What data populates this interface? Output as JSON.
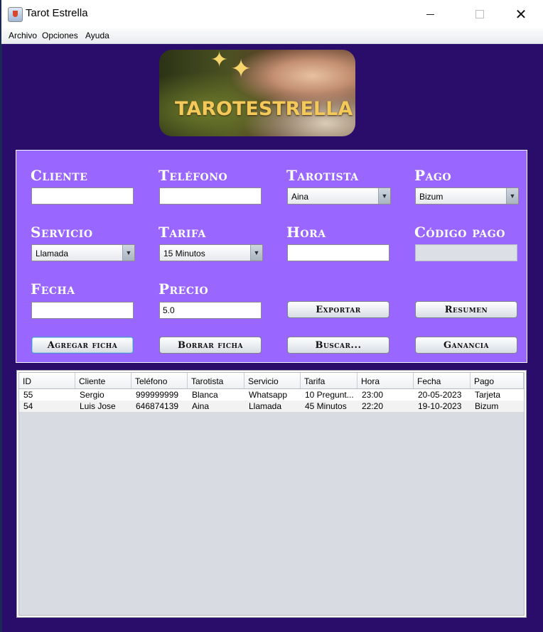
{
  "window": {
    "title": "Tarot Estrella",
    "close_glyph": "✕"
  },
  "menu": {
    "items": [
      "Archivo",
      "Opciones",
      "Ayuda"
    ]
  },
  "banner": {
    "text": "TAROTESTRELLA"
  },
  "form": {
    "cliente": {
      "label": "Cliente",
      "value": ""
    },
    "telefono": {
      "label": "Teléfono",
      "value": ""
    },
    "tarotista": {
      "label": "Tarotista",
      "value": "Aina"
    },
    "pago": {
      "label": "Pago",
      "value": "Bizum"
    },
    "servicio": {
      "label": "Servicio",
      "value": "Llamada"
    },
    "tarifa": {
      "label": "Tarifa",
      "value": "15 Minutos"
    },
    "hora": {
      "label": "Hora",
      "value": ""
    },
    "codigo_pago": {
      "label": "Código pago",
      "value": ""
    },
    "fecha": {
      "label": "Fecha",
      "value": ""
    },
    "precio": {
      "label": "Precio",
      "value": "5.0"
    }
  },
  "buttons": {
    "exportar": "Exportar",
    "resumen": "Resumen",
    "agregar": "Agregar ficha",
    "borrar": "Borrar ficha",
    "buscar": "Buscar...",
    "ganancia": "Ganancia"
  },
  "table": {
    "columns": [
      "ID",
      "Cliente",
      "Teléfono",
      "Tarotista",
      "Servicio",
      "Tarifa",
      "Hora",
      "Fecha",
      "Pago"
    ],
    "rows": [
      [
        "55",
        "Sergio",
        "999999999",
        "Blanca",
        "Whatsapp",
        "10 Pregunt...",
        "23:00",
        "20-05-2023",
        "Tarjeta"
      ],
      [
        "54",
        "Luis Jose",
        "646874139",
        "Aina",
        "Llamada",
        "45 Minutos",
        "22:20",
        "19-10-2023",
        "Bizum"
      ]
    ]
  },
  "colors": {
    "background": "#2a0d6b",
    "panel": "#9966ff",
    "label_text": "#ffffff",
    "banner_text": "#f5c85a"
  }
}
